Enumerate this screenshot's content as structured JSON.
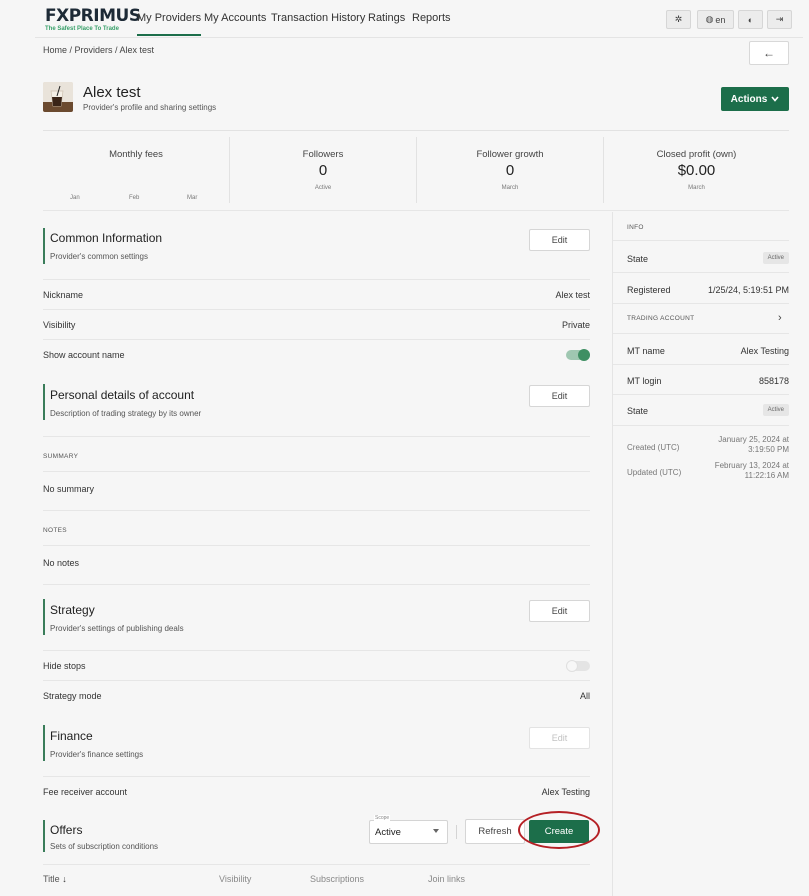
{
  "brand": {
    "logo_text": "FXPRIMUS",
    "tagline": "The Safest Place To Trade",
    "accent": "#1c6e4a"
  },
  "nav": [
    {
      "label": "My Providers"
    },
    {
      "label": "My Accounts"
    },
    {
      "label": "Transaction History"
    },
    {
      "label": "Ratings"
    },
    {
      "label": "Reports"
    }
  ],
  "top_actions": {
    "settings_icon": "gear-icon",
    "language": "en",
    "theme_icon": "contrast-icon",
    "logout_icon": "logout-icon"
  },
  "breadcrumb": "Home / Providers / Alex test",
  "back_icon": "←",
  "provider": {
    "name": "Alex test",
    "subtitle": "Provider's profile and sharing settings",
    "actions_label": "Actions"
  },
  "stats": {
    "monthly_fees": {
      "label": "Monthly fees",
      "months": [
        "Jan",
        "Feb",
        "Mar"
      ]
    },
    "followers": {
      "label": "Followers",
      "value": "0",
      "sub": "Active"
    },
    "follower_growth": {
      "label": "Follower growth",
      "value": "0",
      "sub": "March"
    },
    "closed_profit": {
      "label": "Closed profit (own)",
      "value": "$0.00",
      "sub": "March"
    }
  },
  "common": {
    "title": "Common Information",
    "subtitle": "Provider's common settings",
    "edit": "Edit",
    "rows": [
      {
        "label": "Nickname",
        "value": "Alex test"
      },
      {
        "label": "Visibility",
        "value": "Private"
      },
      {
        "label": "Show account name",
        "value_on": true
      }
    ]
  },
  "personal": {
    "title": "Personal details of account",
    "subtitle": "Description of trading strategy by its owner",
    "edit": "Edit",
    "summary_caption": "SUMMARY",
    "summary_value": "No summary",
    "notes_caption": "NOTES",
    "notes_value": "No notes"
  },
  "strategy": {
    "title": "Strategy",
    "subtitle": "Provider's settings of publishing deals",
    "edit": "Edit",
    "hide_stops_label": "Hide stops",
    "hide_stops_on": false,
    "mode_label": "Strategy mode",
    "mode_value": "All"
  },
  "finance": {
    "title": "Finance",
    "subtitle": "Provider's finance settings",
    "edit": "Edit",
    "fee_label": "Fee receiver account",
    "fee_value": "Alex Testing"
  },
  "offers": {
    "title": "Offers",
    "subtitle": "Sets of subscription conditions",
    "scope_label": "Scope",
    "scope_value": "Active",
    "refresh": "Refresh",
    "create": "Create",
    "columns": [
      "Title",
      "Visibility",
      "Subscriptions",
      "Join links"
    ],
    "sort_icon": "↓"
  },
  "info": {
    "caption": "INFO",
    "state_label": "State",
    "state_value": "Active",
    "registered_label": "Registered",
    "registered_value": "1/25/24, 5:19:51 PM",
    "trading_caption": "TRADING ACCOUNT",
    "mt_name_label": "MT name",
    "mt_name_value": "Alex Testing",
    "mt_login_label": "MT login",
    "mt_login_value": "858178",
    "state2_label": "State",
    "state2_value": "Active",
    "created_label": "Created (UTC)",
    "created_value_1": "January 25, 2024 at",
    "created_value_2": "3:19:50 PM",
    "updated_label": "Updated (UTC)",
    "updated_value_1": "February 13, 2024 at",
    "updated_value_2": "11:22:16 AM"
  }
}
